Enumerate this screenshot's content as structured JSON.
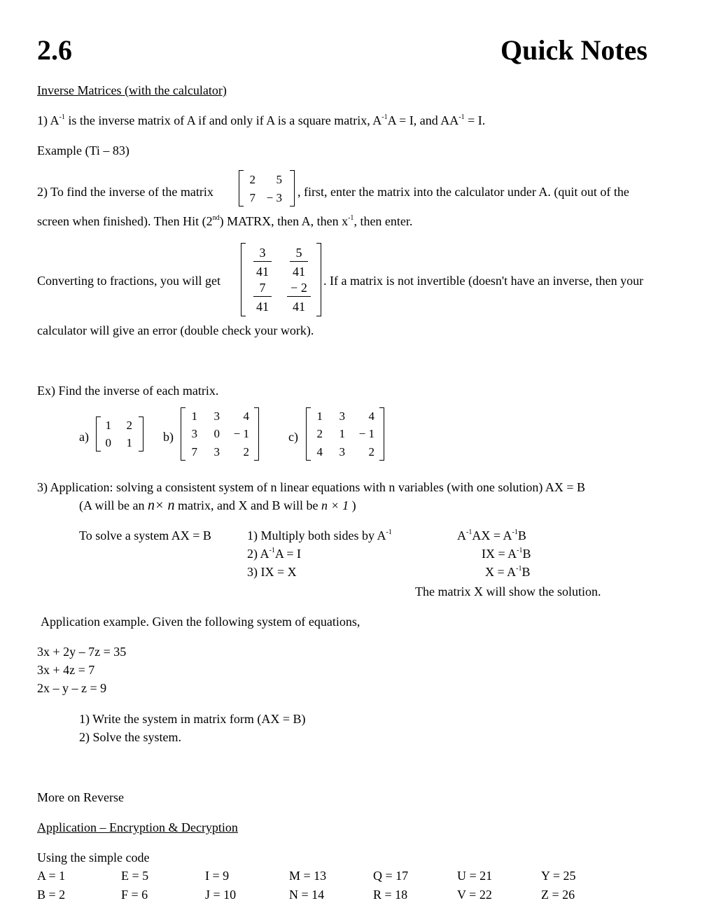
{
  "header": {
    "section": "2.6",
    "title": "Quick Notes"
  },
  "subtitle": "Inverse Matrices (with the calculator)",
  "p1": {
    "pre": "1)  A",
    "sup1": "-1",
    "mid1": " is the inverse matrix of A if and only if A is a square matrix, A",
    "sup2": "-1",
    "mid2": "A = I, and AA",
    "sup3": "-1",
    "end": " = I."
  },
  "example_label": "Example (Ti – 83)",
  "p2": {
    "pre": "2) To find the inverse of the matrix",
    "post": ", first, enter the matrix into the calculator under A. (quit out of the",
    "line2_a": "screen when finished).  Then Hit (2",
    "line2_sup": "nd",
    "line2_b": ") MATRX, then A, then x",
    "line2_sup2": "-1",
    "line2_c": ", then enter.",
    "matrix": [
      [
        "2",
        "5"
      ],
      [
        "7",
        "− 3"
      ]
    ]
  },
  "p3": {
    "pre": "Converting to fractions, you will get",
    "post": ".  If a matrix is not invertible (doesn't have an inverse, then your",
    "line2": "calculator will give an error  (double check your work).",
    "matrix": [
      [
        {
          "num": "3",
          "den": "41"
        },
        {
          "num": "5",
          "den": "41"
        }
      ],
      [
        {
          "num": "7",
          "den": "41"
        },
        {
          "num": "− 2",
          "den": "41"
        }
      ]
    ]
  },
  "ex": {
    "prompt": "Ex) Find the inverse of each matrix.",
    "a_label": "a)",
    "b_label": "b)",
    "c_label": "c)",
    "a": [
      [
        "1",
        "2"
      ],
      [
        "0",
        "1"
      ]
    ],
    "b": [
      [
        "1",
        "3",
        "4"
      ],
      [
        "3",
        "0",
        "− 1"
      ],
      [
        "7",
        "3",
        "2"
      ]
    ],
    "c": [
      [
        "1",
        "3",
        "4"
      ],
      [
        "2",
        "1",
        "− 1"
      ],
      [
        "4",
        "3",
        "2"
      ]
    ]
  },
  "p4": {
    "line1": "3) Application: solving a consistent system of n linear equations with n variables (with one solution) AX = B",
    "line2_a": "(A will be an ",
    "line2_nxn": "n× n",
    "line2_b": " matrix, and X and B will be ",
    "line2_nx1": "n × 1",
    "line2_c": " )",
    "solve_label": "To solve a system AX = B",
    "steps": [
      {
        "a": "1) Multiply both sides by A",
        "sup": "-1",
        "b": ""
      },
      {
        "a": "2) A",
        "sup": "-1",
        "b": "A = I"
      },
      {
        "a": "3) IX = X",
        "sup": "",
        "b": ""
      }
    ],
    "results": [
      {
        "a": "A",
        "sup1": "-1",
        "b": "AX = A",
        "sup2": "-1",
        "c": "B"
      },
      {
        "a": "IX = A",
        "sup1": "-1",
        "b": "B",
        "sup2": "",
        "c": ""
      },
      {
        "a": "X = A",
        "sup1": "-1",
        "b": "B",
        "sup2": "",
        "c": ""
      }
    ],
    "conclusion": "The matrix X will show the solution."
  },
  "app_example": {
    "intro": "Application example.  Given the following system of equations,",
    "equations": [
      "3x + 2y – 7z = 35",
      "3x + 4z = 7",
      "2x – y – z = 9"
    ],
    "tasks": [
      "1) Write the system in matrix form (AX = B)",
      "2) Solve the system."
    ]
  },
  "more": "More on Reverse",
  "encryption": {
    "heading": "Application – Encryption & Decryption",
    "intro": "Using the simple code",
    "row1": [
      "A = 1",
      "E = 5",
      "I = 9",
      "M = 13",
      "Q = 17",
      "U = 21",
      "Y = 25"
    ],
    "row2": [
      "B = 2",
      "F = 6",
      "J = 10",
      "N = 14",
      "R = 18",
      "V = 22",
      "Z = 26"
    ]
  }
}
